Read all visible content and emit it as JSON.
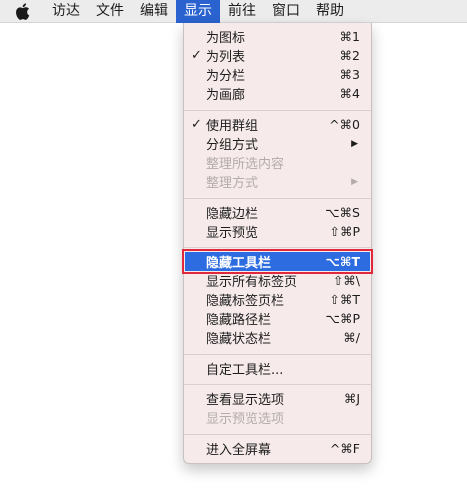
{
  "menubar": {
    "apple_icon": "apple-logo-icon",
    "items": [
      "访达",
      "文件",
      "编辑",
      "显示",
      "前往",
      "窗口",
      "帮助"
    ],
    "active_index": 3
  },
  "menu": {
    "group1": [
      {
        "label": "为图标",
        "shortcut": "⌘1",
        "checked": false
      },
      {
        "label": "为列表",
        "shortcut": "⌘2",
        "checked": true
      },
      {
        "label": "为分栏",
        "shortcut": "⌘3",
        "checked": false
      },
      {
        "label": "为画廊",
        "shortcut": "⌘4",
        "checked": false
      }
    ],
    "group2": [
      {
        "label": "使用群组",
        "shortcut": "^⌘0",
        "checked": true
      },
      {
        "label": "分组方式",
        "submenu": true
      },
      {
        "label": "整理所选内容",
        "disabled": true
      },
      {
        "label": "整理方式",
        "submenu": true,
        "disabled": true
      }
    ],
    "group3": [
      {
        "label": "隐藏边栏",
        "shortcut": "⌥⌘S"
      },
      {
        "label": "显示预览",
        "shortcut": "⇧⌘P"
      }
    ],
    "group4": [
      {
        "label": "隐藏工具栏",
        "shortcut": "⌥⌘T",
        "highlighted": true
      },
      {
        "label": "显示所有标签页",
        "shortcut": "⇧⌘\\"
      },
      {
        "label": "隐藏标签页栏",
        "shortcut": "⇧⌘T"
      },
      {
        "label": "隐藏路径栏",
        "shortcut": "⌥⌘P"
      },
      {
        "label": "隐藏状态栏",
        "shortcut": "⌘/"
      }
    ],
    "group5": [
      {
        "label": "自定工具栏..."
      }
    ],
    "group6": [
      {
        "label": "查看显示选项",
        "shortcut": "⌘J"
      },
      {
        "label": "显示预览选项",
        "disabled": true
      }
    ],
    "group7": [
      {
        "label": "进入全屏幕",
        "shortcut": "^⌘F"
      }
    ],
    "check_mark": "✓",
    "submenu_arrow": "▶"
  },
  "colors": {
    "menubar_bg": "#ececec",
    "active_menu_bg": "#2a63cf",
    "menu_bg": "#f6eaea",
    "highlight_bg": "#2d6be0",
    "highlight_outline": "#e0283a",
    "disabled_text": "#b4acac"
  }
}
